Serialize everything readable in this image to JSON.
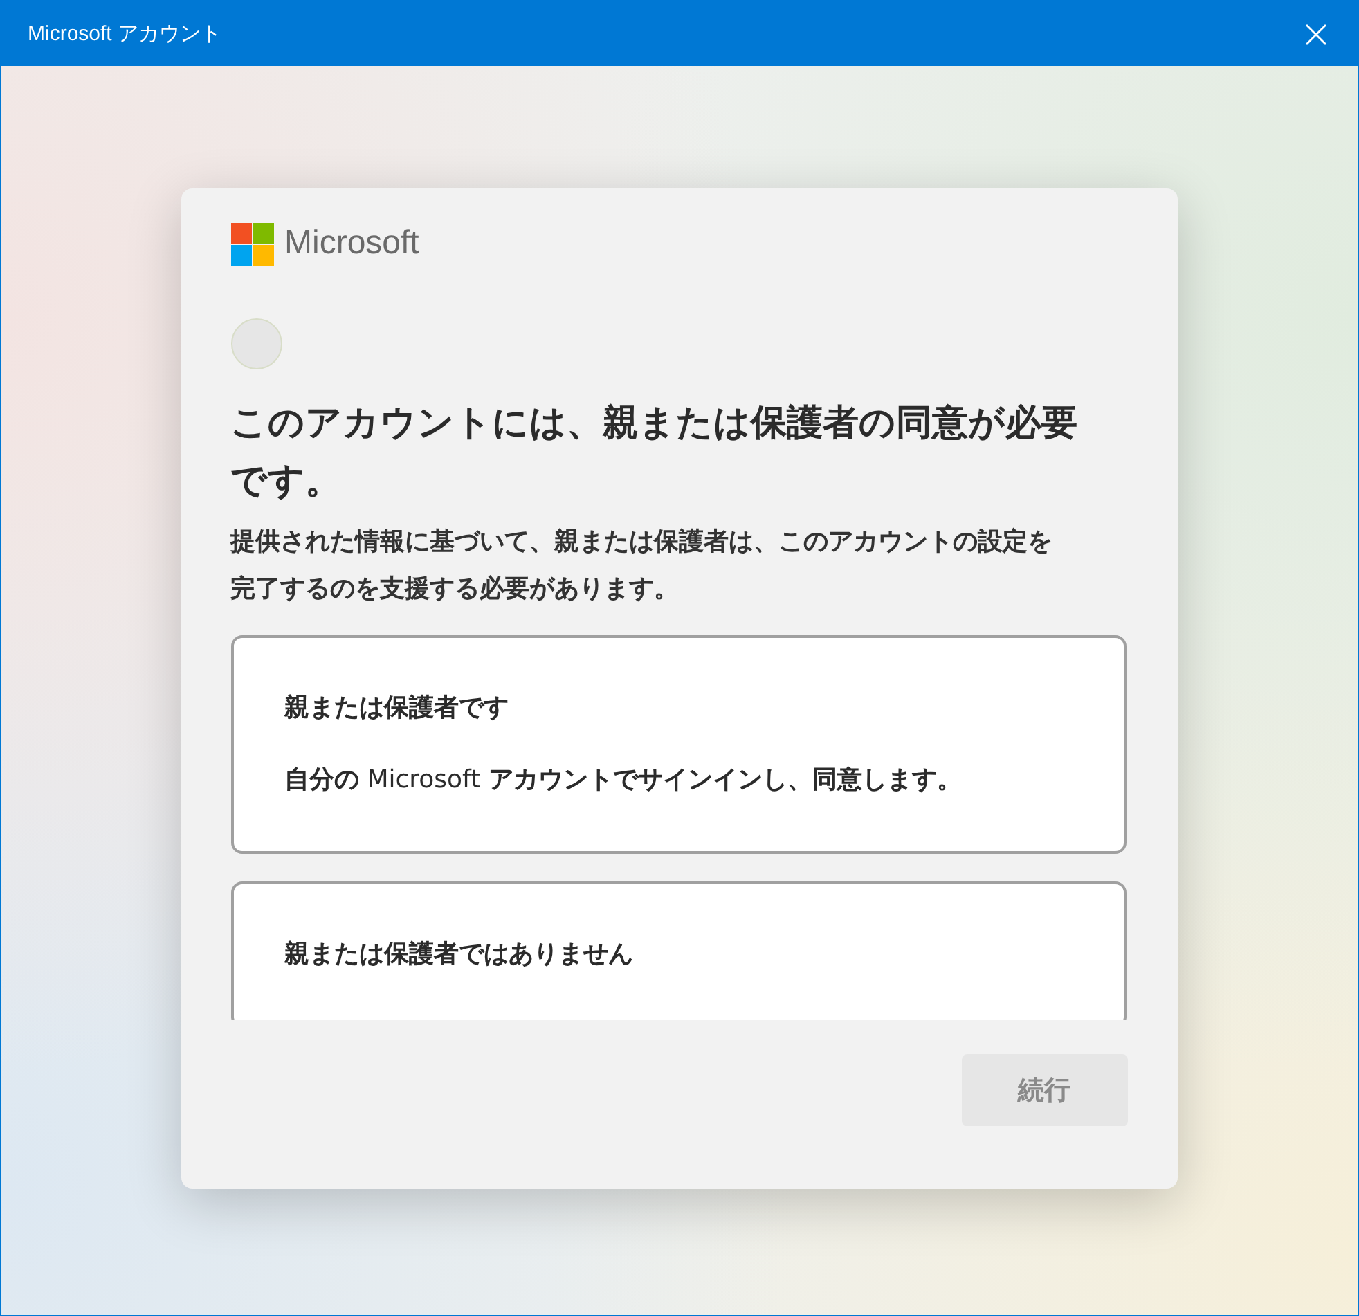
{
  "window": {
    "title": "Microsoft アカウント"
  },
  "logo": {
    "text": "Microsoft"
  },
  "heading": "このアカウントには、親または保護者の同意が必要です。",
  "description": "提供された情報に基づいて、親または保護者は、このアカウントの設定を完了するのを支援する必要があります。",
  "options": [
    {
      "title": "親または保護者です",
      "detail": "**自分の** Microsoft **アカウントでサインインし、同意します。**"
    },
    {
      "title": "親または保護者ではありません"
    }
  ],
  "continue_button": {
    "label": "続行",
    "disabled": true
  }
}
